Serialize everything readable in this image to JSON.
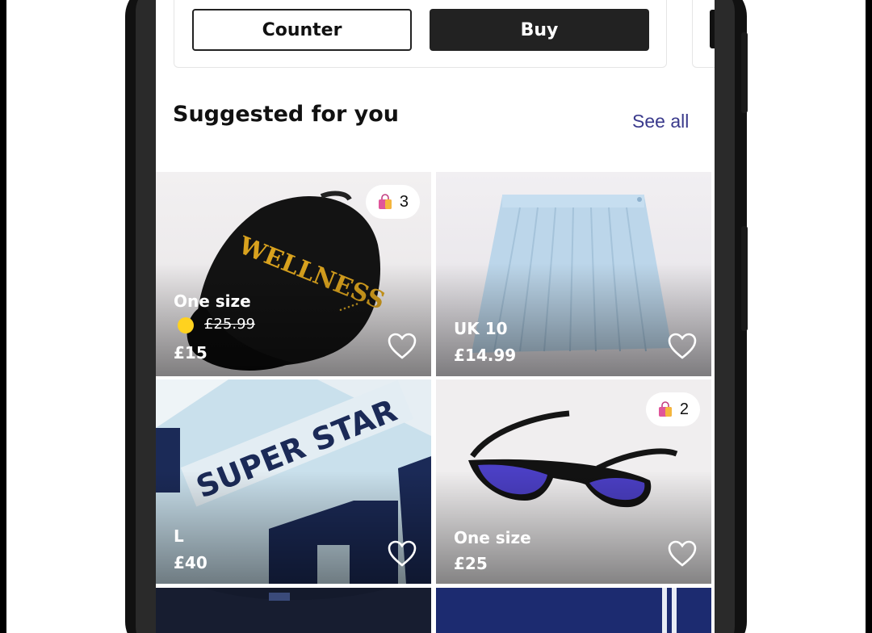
{
  "offer": {
    "counter_label": "Counter",
    "buy_label": "Buy"
  },
  "section": {
    "title": "Suggested for you",
    "see_all": "See all"
  },
  "products": [
    {
      "size": "One size",
      "original_price": "£25.99",
      "price": "£15",
      "bag_count": "3",
      "boosted": true,
      "print": "WELLNESS"
    },
    {
      "size": "UK 10",
      "price": "£14.99"
    },
    {
      "size": "L",
      "price": "£40",
      "print": "SUPER STAR"
    },
    {
      "size": "One size",
      "price": "£25",
      "bag_count": "2"
    }
  ],
  "colors": {
    "buy_button": "#222222",
    "see_all_link": "#3a3a8c",
    "boost_dot": "#ffd21f",
    "bag_icon": "#e0559a"
  },
  "icons": [
    "heart-icon",
    "shopping-bag-icon",
    "boost-icon"
  ]
}
